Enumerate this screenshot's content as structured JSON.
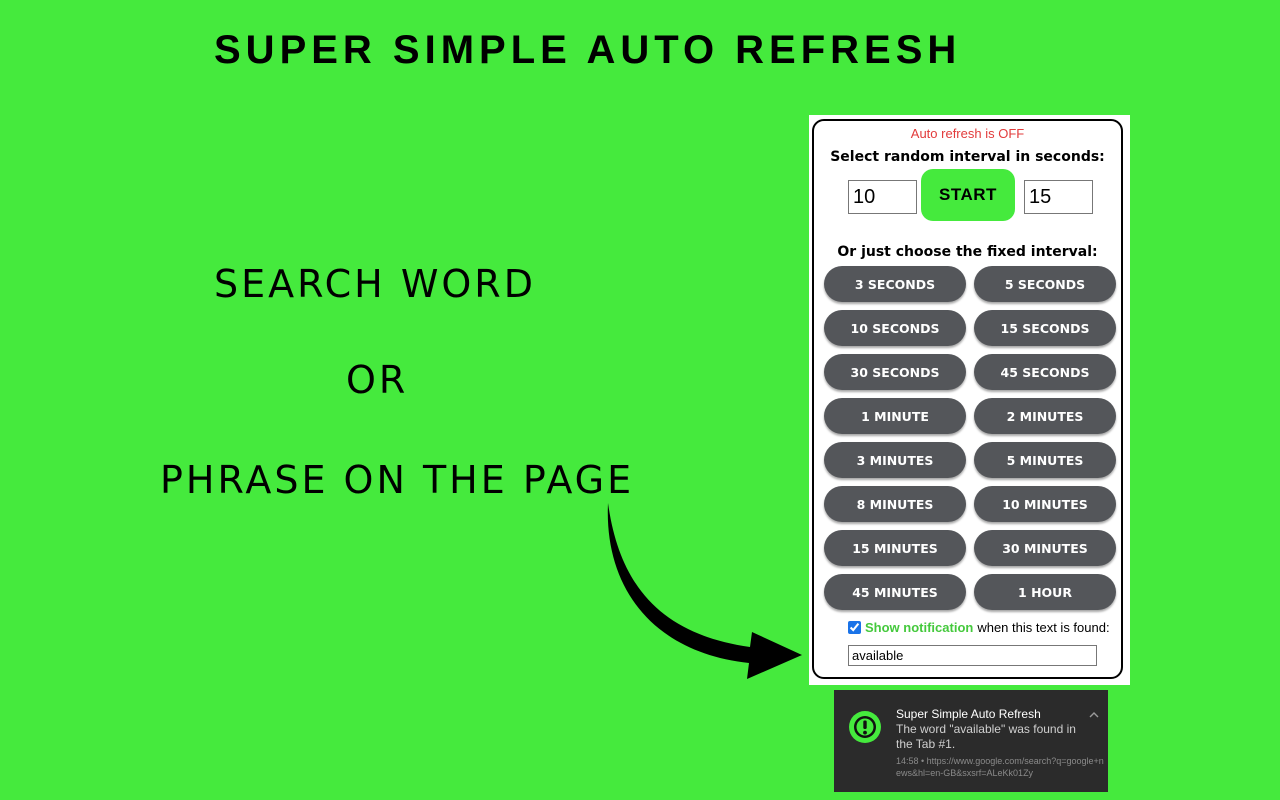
{
  "headline": "SUPER SIMPLE AUTO REFRESH",
  "taglines": [
    "SEARCH WORD",
    "OR",
    "PHRASE ON THE PAGE"
  ],
  "colors": {
    "background": "#45ea3d",
    "accent": "#45ea3d",
    "status_off": "#e23b3b",
    "button_dark": "#54565a"
  },
  "popup": {
    "status": "Auto refresh is OFF",
    "random_label": "Select random interval in seconds:",
    "random_min": "10",
    "random_max": "15",
    "start_label": "START",
    "fixed_label": "Or just choose the fixed interval:",
    "intervals": [
      "3 SECONDS",
      "5 SECONDS",
      "10 SECONDS",
      "15 SECONDS",
      "30 SECONDS",
      "45 SECONDS",
      "1 MINUTE",
      "2 MINUTES",
      "3 MINUTES",
      "5 MINUTES",
      "8 MINUTES",
      "10 MINUTES",
      "15 MINUTES",
      "30 MINUTES",
      "45 MINUTES",
      "1 HOUR"
    ],
    "notify_checked": true,
    "notify_strong": "Show notification",
    "notify_rest": "when this text is found:",
    "search_text": "available"
  },
  "toast": {
    "icon": "exclamation-circle-icon",
    "title": "Super Simple Auto Refresh",
    "body": "The word \"available\" was found in the Tab #1.",
    "meta": "14:58 • https://www.google.com/search?q=google+news&hl=en-GB&sxsrf=ALeKk01Zy"
  }
}
